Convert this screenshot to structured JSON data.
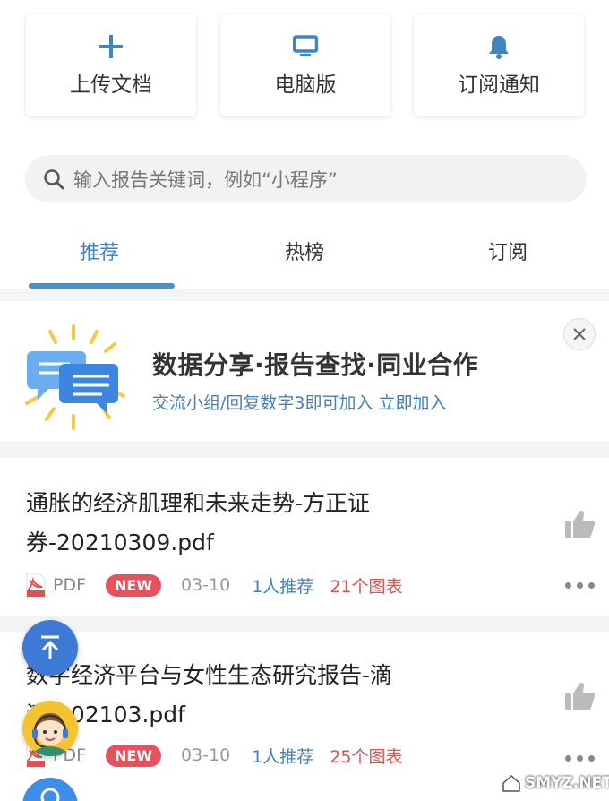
{
  "actions": {
    "upload": {
      "label": "上传文档",
      "icon": "plus-icon"
    },
    "pc": {
      "label": "电脑版",
      "icon": "monitor-icon"
    },
    "subscribe": {
      "label": "订阅通知",
      "icon": "bell-icon"
    }
  },
  "search": {
    "placeholder": "输入报告关键词，例如“小程序”"
  },
  "tabs": [
    {
      "label": "推荐",
      "active": true
    },
    {
      "label": "热榜",
      "active": false
    },
    {
      "label": "订阅",
      "active": false
    }
  ],
  "banner": {
    "title": "数据分享·报告查找·同业合作",
    "subtitle": "交流小组/回复数字3即可加入",
    "join_link": "立即加入"
  },
  "documents": [
    {
      "title": "通胀的经济肌理和未来走势-方正证券-20210309.pdf",
      "type": "PDF",
      "badge": "NEW",
      "date": "03-10",
      "recommend": "1人推荐",
      "charts": "21个图表"
    },
    {
      "title": "数字经济平台与女性生态研究报告-滴滴-202103.pdf",
      "type": "PDF",
      "badge": "NEW",
      "date": "03-10",
      "recommend": "1人推荐",
      "charts": "25个图表"
    }
  ],
  "watermark": "SMYZ.NET",
  "colors": {
    "accent": "#3f84c4",
    "new_badge": "#e8505b",
    "charts_text": "#d9534f"
  }
}
